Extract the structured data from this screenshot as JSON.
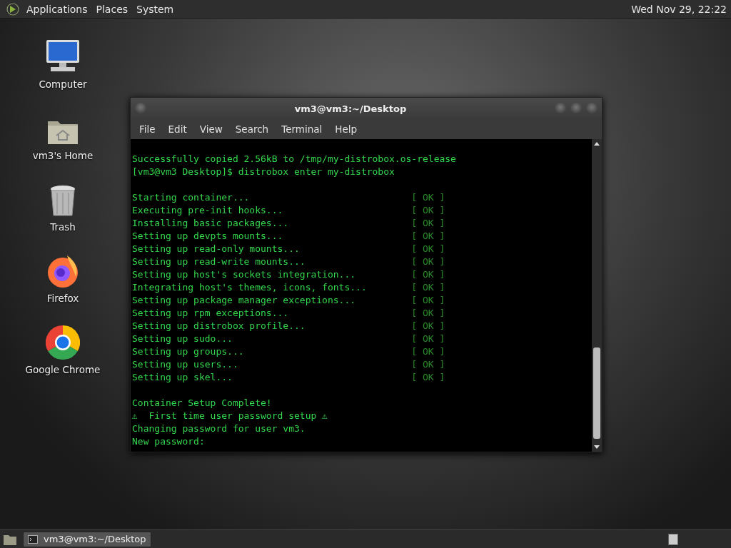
{
  "top_panel": {
    "menus": [
      "Applications",
      "Places",
      "System"
    ],
    "clock": "Wed Nov 29, 22:22"
  },
  "desktop_icons": [
    {
      "kind": "computer",
      "label": "Computer"
    },
    {
      "kind": "home",
      "label": "vm3's Home"
    },
    {
      "kind": "trash",
      "label": "Trash"
    },
    {
      "kind": "firefox",
      "label": "Firefox"
    },
    {
      "kind": "chrome",
      "label": "Google Chrome"
    }
  ],
  "terminal_window": {
    "title": "vm3@vm3:~/Desktop",
    "menu": [
      "File",
      "Edit",
      "View",
      "Search",
      "Terminal",
      "Help"
    ],
    "lines": [
      {
        "kind": "text",
        "text": "Successfully copied 2.56kB to /tmp/my-distrobox.os-release"
      },
      {
        "kind": "text",
        "text": "[vm3@vm3 Desktop]$ distrobox enter my-distrobox"
      },
      {
        "kind": "blank"
      },
      {
        "kind": "status",
        "text": "Starting container...",
        "status": "[ OK ]"
      },
      {
        "kind": "status",
        "text": "Executing pre-init hooks...",
        "status": "[ OK ]"
      },
      {
        "kind": "status",
        "text": "Installing basic packages...",
        "status": "[ OK ]"
      },
      {
        "kind": "status",
        "text": "Setting up devpts mounts...",
        "status": "[ OK ]"
      },
      {
        "kind": "status",
        "text": "Setting up read-only mounts...",
        "status": "[ OK ]"
      },
      {
        "kind": "status",
        "text": "Setting up read-write mounts...",
        "status": "[ OK ]"
      },
      {
        "kind": "status",
        "text": "Setting up host's sockets integration...",
        "status": "[ OK ]"
      },
      {
        "kind": "status",
        "text": "Integrating host's themes, icons, fonts...",
        "status": "[ OK ]"
      },
      {
        "kind": "status",
        "text": "Setting up package manager exceptions...",
        "status": "[ OK ]"
      },
      {
        "kind": "status",
        "text": "Setting up rpm exceptions...",
        "status": "[ OK ]"
      },
      {
        "kind": "status",
        "text": "Setting up distrobox profile...",
        "status": "[ OK ]"
      },
      {
        "kind": "status",
        "text": "Setting up sudo...",
        "status": "[ OK ]"
      },
      {
        "kind": "status",
        "text": "Setting up groups...",
        "status": "[ OK ]"
      },
      {
        "kind": "status",
        "text": "Setting up users...",
        "status": "[ OK ]"
      },
      {
        "kind": "status",
        "text": "Setting up skel...",
        "status": "[ OK ]"
      },
      {
        "kind": "blank"
      },
      {
        "kind": "text",
        "text": "Container Setup Complete!"
      },
      {
        "kind": "text",
        "text": "⚠  First time user password setup ⚠"
      },
      {
        "kind": "text",
        "text": "Changing password for user vm3."
      },
      {
        "kind": "text",
        "text": "New password:"
      }
    ]
  },
  "taskbar": {
    "tasks": [
      {
        "label": "vm3@vm3:~/Desktop",
        "selected": true
      }
    ]
  }
}
